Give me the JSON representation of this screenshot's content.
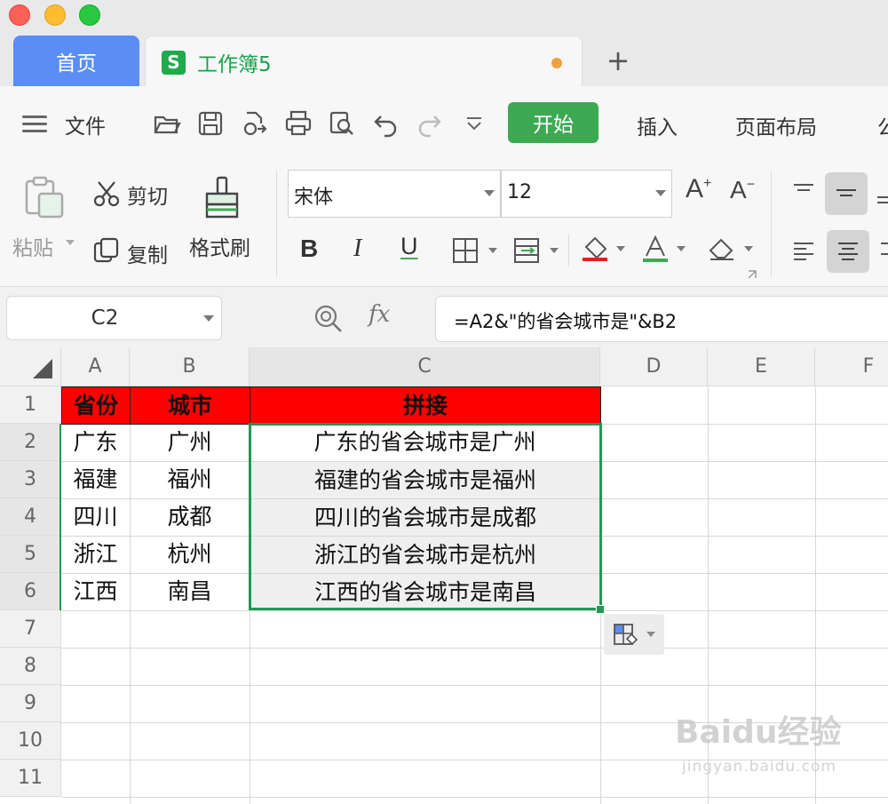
{
  "tabs": {
    "home": "首页",
    "doc_icon": "S",
    "doc_title": "工作簿5",
    "add": "+"
  },
  "menu": {
    "file": "文件",
    "start": "开始",
    "insert": "插入",
    "page_layout": "页面布局",
    "overflow": "公"
  },
  "ribbon": {
    "paste": "粘贴",
    "cut": "剪切",
    "copy": "复制",
    "format_painter": "格式刷",
    "font_name": "宋体",
    "font_size": "12",
    "bold": "B",
    "italic": "I",
    "underline": "U",
    "font_increase": "A",
    "font_decrease": "A"
  },
  "formula_bar": {
    "name_box": "C2",
    "fx": "fx",
    "formula": "=A2&\"的省会城市是\"&B2"
  },
  "sheet": {
    "columns": [
      "A",
      "B",
      "C",
      "D",
      "E",
      "F"
    ],
    "rows": [
      "1",
      "2",
      "3",
      "4",
      "5",
      "6",
      "7",
      "8",
      "9",
      "10",
      "11"
    ],
    "header": {
      "A": "省份",
      "B": "城市",
      "C": "拼接"
    },
    "data": [
      {
        "A": "广东",
        "B": "广州",
        "C": "广东的省会城市是广州"
      },
      {
        "A": "福建",
        "B": "福州",
        "C": "福建的省会城市是福州"
      },
      {
        "A": "四川",
        "B": "成都",
        "C": "四川的省会城市是成都"
      },
      {
        "A": "浙江",
        "B": "杭州",
        "C": "浙江的省会城市是杭州"
      },
      {
        "A": "江西",
        "B": "南昌",
        "C": "江西的省会城市是南昌"
      }
    ],
    "selected_range": "C2:C6"
  },
  "watermark": {
    "brand": "Baidu经验",
    "url": "jingyan.baidu.com"
  },
  "colors": {
    "accent_green": "#3ea953",
    "home_tab_blue": "#5b8ef5",
    "header_fill": "#ff0000",
    "selection": "#1f9a52"
  }
}
